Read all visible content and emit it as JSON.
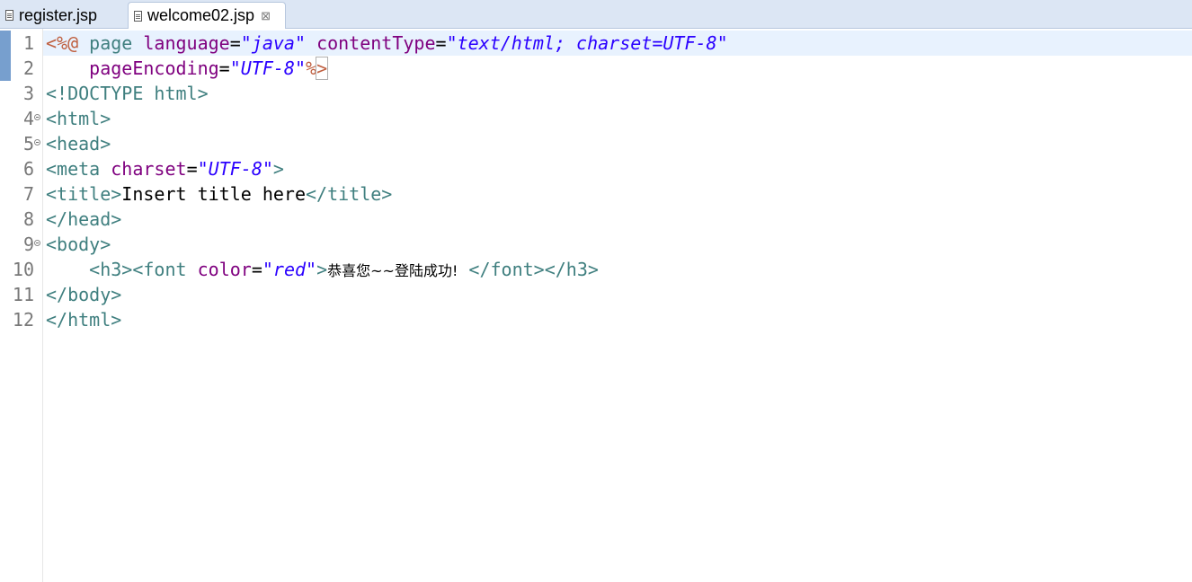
{
  "tabs": [
    {
      "label": "register.jsp",
      "active": false
    },
    {
      "label": "welcome02.jsp",
      "active": true,
      "close_glyph": "⊠"
    }
  ],
  "editor": {
    "lines": [
      {
        "num": "1"
      },
      {
        "num": "2"
      },
      {
        "num": "3"
      },
      {
        "num": "4"
      },
      {
        "num": "5"
      },
      {
        "num": "6"
      },
      {
        "num": "7"
      },
      {
        "num": "8"
      },
      {
        "num": "9"
      },
      {
        "num": "10"
      },
      {
        "num": "11"
      },
      {
        "num": "12"
      }
    ],
    "tokens": {
      "l1": [
        "<%@",
        " ",
        "page",
        " ",
        "language",
        "=",
        "\"java\"",
        " ",
        "contentType",
        "=",
        "\"text/html; charset=UTF-8\""
      ],
      "l2": [
        "    ",
        "pageEncoding",
        "=",
        "\"UTF-8\"",
        "%",
        ">"
      ],
      "l3": [
        "<!DOCTYPE",
        " ",
        "html",
        ">"
      ],
      "l4": [
        "<html>"
      ],
      "l5": [
        "<head>"
      ],
      "l6": [
        "<meta",
        " ",
        "charset",
        "=",
        "\"UTF-8\"",
        ">"
      ],
      "l7": [
        "<title>",
        "Insert title here",
        "</title>"
      ],
      "l8": [
        "</head>"
      ],
      "l9": [
        "<body>"
      ],
      "l10": [
        "    ",
        "<h3>",
        "<font",
        " ",
        "color",
        "=",
        "\"red\"",
        ">",
        "恭喜您~~登陆成功!",
        " ",
        "</font>",
        "</h3>"
      ],
      "l11": [
        "</body>"
      ],
      "l12": [
        "</html>"
      ]
    }
  },
  "colors": {
    "jsp_delimiter": "#bf5f3f",
    "tag": "#3f7f7f",
    "attribute": "#7f007f",
    "string": "#2a00ff",
    "current_line": "#e8f2fe",
    "tab_bar": "#dce6f4"
  }
}
